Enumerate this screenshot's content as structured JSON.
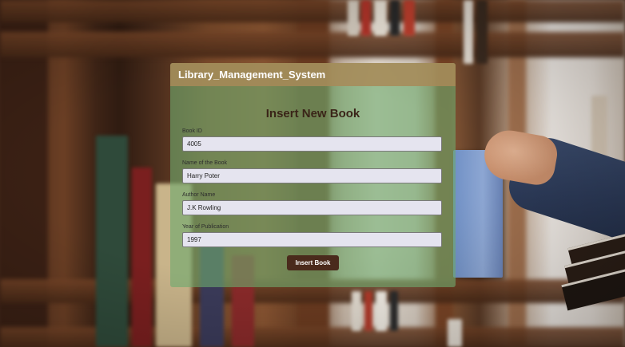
{
  "app": {
    "title": "Library_Management_System"
  },
  "form": {
    "title": "Insert New Book",
    "fields": [
      {
        "label": "Book ID",
        "value": "4005"
      },
      {
        "label": "Name of the Book",
        "value": "Harry Poter"
      },
      {
        "label": "Author Name",
        "value": "J.K Rowling"
      },
      {
        "label": "Year of Publication",
        "value": "1997"
      }
    ],
    "submit_label": "Insert Book"
  },
  "colors": {
    "card_bg": "#6eaa6e",
    "header_bg": "#a88a58",
    "button_bg": "#4a2a1c",
    "input_bg": "#e5e4ef"
  }
}
